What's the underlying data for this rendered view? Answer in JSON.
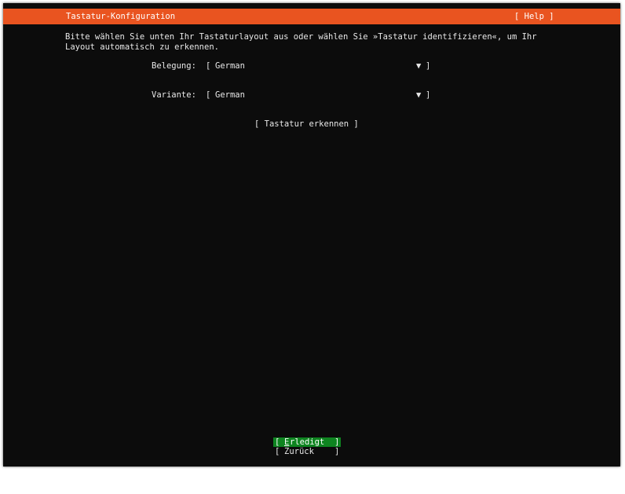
{
  "header": {
    "title": "Tastatur-Konfiguration",
    "help_label": "[ Help ]"
  },
  "intro": {
    "line1": "Bitte wählen Sie unten Ihr Tastaturlayout aus oder wählen Sie »Tastatur identifizieren«, um Ihr",
    "line2": "Layout automatisch zu erkennen."
  },
  "form": {
    "layout": {
      "label": "Belegung:",
      "value": "German",
      "arrow": "▼"
    },
    "variant": {
      "label": "Variante:",
      "value": "German",
      "arrow": "▼"
    },
    "bracket_open": "[",
    "bracket_close": "]"
  },
  "identify_button": "[ Tastatur erkennen ]",
  "buttons": {
    "done": {
      "open": "[",
      "first": "E",
      "rest": "rledigt",
      "close": "]"
    },
    "back": {
      "open": "[",
      "label": "Zurück",
      "close": "]"
    }
  },
  "colors": {
    "header_bg": "#e95420",
    "focused_button_bg": "#0e8420",
    "background": "#0c0c0c"
  }
}
